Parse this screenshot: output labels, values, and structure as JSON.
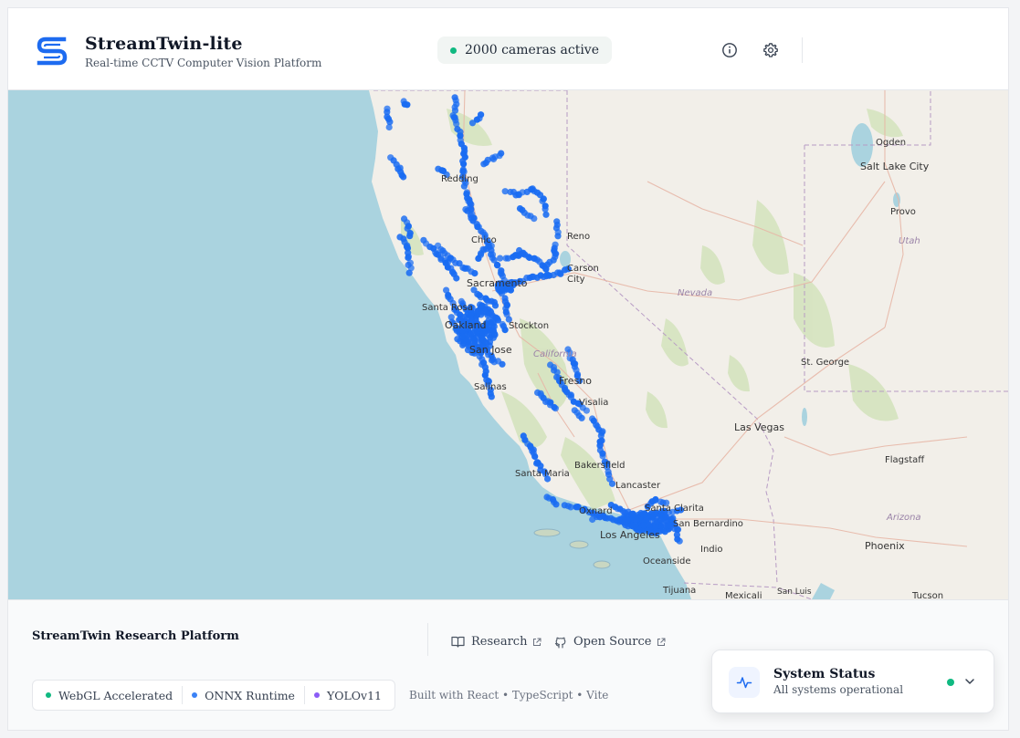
{
  "colors": {
    "brand": "#1d6bf0",
    "camera_dot": "#1a6cf2",
    "active": "#10b981",
    "onnx": "#3b82f6",
    "yolo": "#8b5cf6"
  },
  "header": {
    "title": "StreamTwin-lite",
    "subtitle": "Real-time CCTV Computer Vision Platform",
    "camera_status": "2000 cameras active",
    "icons": [
      "info-icon",
      "settings-gear-icon"
    ]
  },
  "map": {
    "labels": {
      "ogden": "Ogden",
      "salt_lake_city": "Salt Lake City",
      "provo": "Provo",
      "utah": "Utah",
      "redding": "Redding",
      "chico": "Chico",
      "reno": "Reno",
      "carson_city_1": "Carson",
      "carson_city_2": "City",
      "sacramento": "Sacramento",
      "nevada": "Nevada",
      "santa_rosa": "Santa Rosa",
      "stockton": "Stockton",
      "oakland": "Oakland",
      "san_jose": "San Jose",
      "california": "California",
      "salinas": "Salinas",
      "fresno": "Fresno",
      "visalia": "Visalia",
      "st_george": "St. George",
      "las_vegas": "Las Vegas",
      "bakersfield": "Bakersfield",
      "flagstaff": "Flagstaff",
      "santa_maria": "Santa Maria",
      "lancaster": "Lancaster",
      "oxnard": "Oxnard",
      "santa_clarita": "Santa Clarita",
      "san_bernardino": "San Bernardino",
      "arizona": "Arizona",
      "los_angeles": "Los Angeles",
      "indio": "Indio",
      "phoenix": "Phoenix",
      "oceanside": "Oceanside",
      "tijuana": "Tijuana",
      "mexicali": "Mexicali",
      "san_luis": "San Luis",
      "tucson": "Tucson"
    }
  },
  "footer": {
    "title": "StreamTwin Research Platform",
    "links": [
      "Research",
      "Open Source"
    ],
    "badges": [
      {
        "label": "WebGL Accelerated",
        "color": "#10b981"
      },
      {
        "label": "ONNX Runtime",
        "color": "#3b82f6"
      },
      {
        "label": "YOLOv11",
        "color": "#8b5cf6"
      }
    ],
    "built_with": "Built with React • TypeScript • Vite"
  },
  "status": {
    "title": "System Status",
    "subtitle": "All systems operational"
  }
}
